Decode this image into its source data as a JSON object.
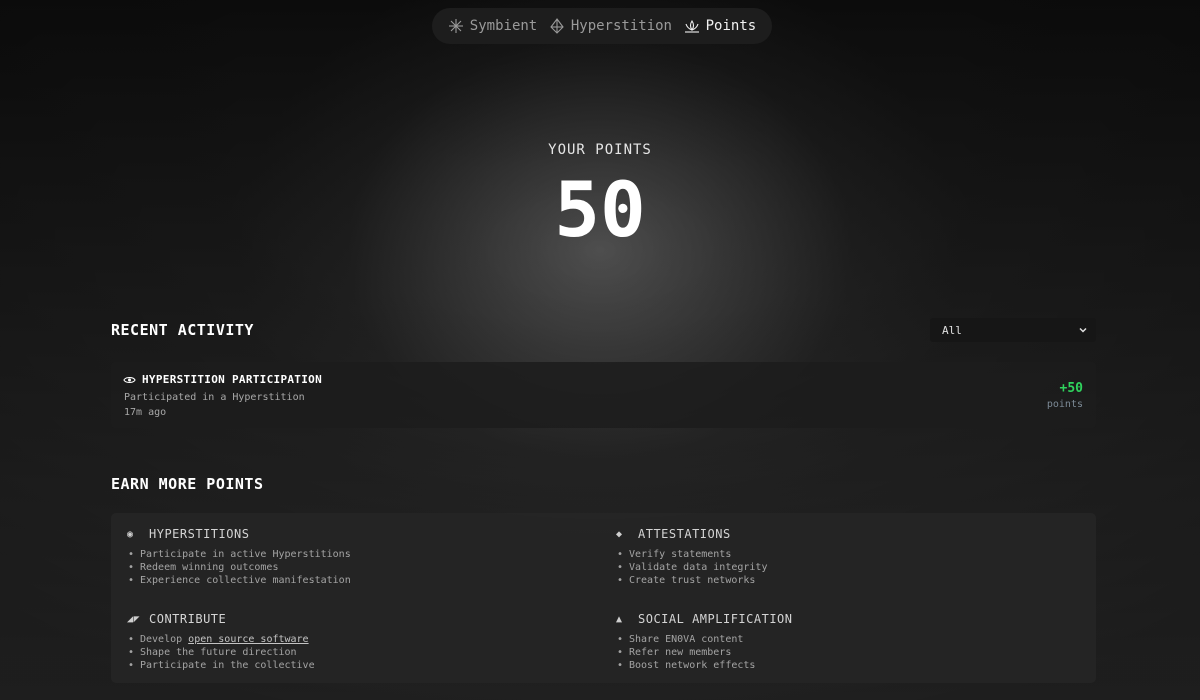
{
  "nav": {
    "items": [
      {
        "label": "Symbient",
        "icon": "sparkle-icon",
        "active": false
      },
      {
        "label": "Hyperstition",
        "icon": "diamond-icon",
        "active": false
      },
      {
        "label": "Points",
        "icon": "lotus-icon",
        "active": true
      }
    ]
  },
  "points": {
    "label": "YOUR POINTS",
    "value": "50"
  },
  "recent": {
    "title": "RECENT ACTIVITY",
    "filter": {
      "selected": "All"
    },
    "items": [
      {
        "icon": "eye-icon",
        "title": "HYPERSTITION PARTICIPATION",
        "description": "Participated in a Hyperstition",
        "time": "17m ago",
        "amount": "+50",
        "unit": "points"
      }
    ]
  },
  "earn": {
    "title": "EARN MORE POINTS",
    "groups": [
      {
        "icon": "◉",
        "icon_name": "target-icon",
        "title": "HYPERSTITIONS",
        "items": [
          "Participate in active Hyperstitions",
          "Redeem winning outcomes",
          "Experience collective manifestation"
        ]
      },
      {
        "icon": "◆",
        "icon_name": "diamond-icon",
        "title": "ATTESTATIONS",
        "items": [
          "Verify statements",
          "Validate data integrity",
          "Create trust networks"
        ]
      },
      {
        "icon": "◢◤",
        "icon_name": "contribute-icon",
        "title": "CONTRIBUTE",
        "items_prefix": "Develop ",
        "items_link": "open source software",
        "items": [
          "Shape the future direction",
          "Participate in the collective"
        ]
      },
      {
        "icon": "▲",
        "icon_name": "triangle-icon",
        "title": "SOCIAL AMPLIFICATION",
        "items": [
          "Share EN0VA content",
          "Refer new members",
          "Boost network effects"
        ]
      }
    ]
  },
  "colors": {
    "positive": "#2fd35d",
    "muted": "#a4a4a4"
  }
}
